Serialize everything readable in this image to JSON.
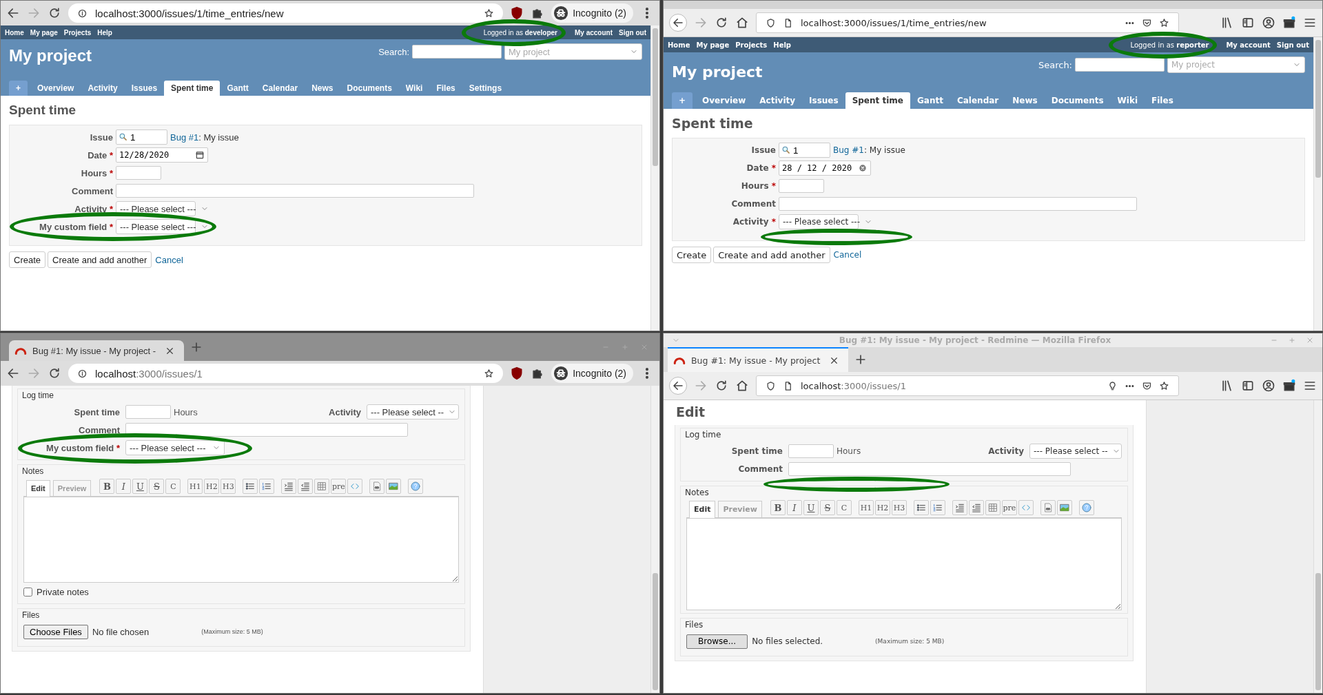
{
  "windows": [
    {
      "kind": "chrome",
      "address": {
        "host": "localhost",
        "path": ":3000/issues/1/time_entries/new",
        "path_dimmed": false
      },
      "profile": "Incognito (2)",
      "page": {
        "kind": "time_entry_form",
        "header": {
          "menu": [
            "Home",
            "My page",
            "Projects",
            "Help"
          ],
          "logged_in_label": "Logged in as",
          "user": "developer",
          "user_circled": true,
          "account_links": [
            "My account",
            "Sign out"
          ],
          "project": "My project",
          "search_label": "Search:",
          "jump": "My project",
          "tabs": [
            {
              "label": "+",
              "kind": "plus",
              "selected": false
            },
            {
              "label": "Overview",
              "kind": "menu",
              "selected": false
            },
            {
              "label": "Activity",
              "kind": "menu",
              "selected": false
            },
            {
              "label": "Issues",
              "kind": "menu",
              "selected": false
            },
            {
              "label": "Spent time",
              "kind": "menu",
              "selected": true
            },
            {
              "label": "Gantt",
              "kind": "menu",
              "selected": false
            },
            {
              "label": "Calendar",
              "kind": "menu",
              "selected": false
            },
            {
              "label": "News",
              "kind": "menu",
              "selected": false
            },
            {
              "label": "Documents",
              "kind": "menu",
              "selected": false
            },
            {
              "label": "Wiki",
              "kind": "menu",
              "selected": false
            },
            {
              "label": "Files",
              "kind": "menu",
              "selected": false
            },
            {
              "label": "Settings",
              "kind": "menu",
              "selected": false
            }
          ]
        },
        "heading": "Spent time",
        "form": {
          "rows": [
            {
              "kind": "issue",
              "label": "Issue",
              "value": "1",
              "link": "Bug #1",
              "text": ": My issue"
            },
            {
              "kind": "date",
              "label": "Date",
              "required_mark": "*",
              "value": "12/28/2020"
            },
            {
              "kind": "short",
              "label": "Hours",
              "required_mark": "*"
            },
            {
              "kind": "long",
              "label": "Comment"
            },
            {
              "kind": "select",
              "label": "Activity",
              "required_mark": "*",
              "value": "--- Please select ---"
            },
            {
              "kind": "select",
              "label": "My custom field",
              "required_mark": "*",
              "value": "--- Please select ---",
              "circled": true
            }
          ],
          "buttons": [
            "Create",
            "Create and add another"
          ],
          "cancel": "Cancel"
        }
      }
    },
    {
      "kind": "firefox",
      "tab_strip": {
        "kind": "partial"
      },
      "address": {
        "host": "localhost",
        "path": ":3000/issues/1/time_entries/new",
        "path_dimmed": false
      },
      "page": {
        "kind": "time_entry_form",
        "header": {
          "menu": [
            "Home",
            "My page",
            "Projects",
            "Help"
          ],
          "logged_in_label": "Logged in as",
          "user": "reporter",
          "user_circled": true,
          "account_links": [
            "My account",
            "Sign out"
          ],
          "project": "My project",
          "search_label": "Search:",
          "jump": "My project",
          "tabs": [
            {
              "label": "+",
              "kind": "plus",
              "selected": false
            },
            {
              "label": "Overview",
              "kind": "menu",
              "selected": false
            },
            {
              "label": "Activity",
              "kind": "menu",
              "selected": false
            },
            {
              "label": "Issues",
              "kind": "menu",
              "selected": false
            },
            {
              "label": "Spent time",
              "kind": "menu",
              "selected": true
            },
            {
              "label": "Gantt",
              "kind": "menu",
              "selected": false
            },
            {
              "label": "Calendar",
              "kind": "menu",
              "selected": false
            },
            {
              "label": "News",
              "kind": "menu",
              "selected": false
            },
            {
              "label": "Documents",
              "kind": "menu",
              "selected": false
            },
            {
              "label": "Wiki",
              "kind": "menu",
              "selected": false
            },
            {
              "label": "Files",
              "kind": "menu",
              "selected": false
            }
          ]
        },
        "heading": "Spent time",
        "form": {
          "rows": [
            {
              "kind": "issue",
              "label": "Issue",
              "value": "1",
              "link": "Bug #1",
              "text": ": My issue"
            },
            {
              "kind": "date",
              "label": "Date",
              "required_mark": "*",
              "value": "28 / 12 / 2020"
            },
            {
              "kind": "short",
              "label": "Hours",
              "required_mark": "*"
            },
            {
              "kind": "long",
              "label": "Comment"
            },
            {
              "kind": "select",
              "label": "Activity",
              "required_mark": "*",
              "value": "--- Please select ---"
            }
          ],
          "circled_gap": true,
          "buttons": [
            "Create",
            "Create and add another"
          ],
          "cancel": "Cancel"
        }
      }
    },
    {
      "kind": "chrome",
      "tab_strip": {
        "kind": "full",
        "title": "Bug #1: My issue - My project -"
      },
      "address": {
        "host": "localhost",
        "path": ":3000/issues/1",
        "path_dimmed": true
      },
      "profile": "Incognito (2)",
      "page": {
        "kind": "issue_edit",
        "log_time": {
          "legend": "Log time",
          "spent_label": "Spent time",
          "unit": "Hours",
          "activity_label": "Activity",
          "activity_value": "--- Please select --",
          "comment_label": "Comment",
          "custom_field": {
            "label": "My custom field",
            "required_mark": "*",
            "value": "--- Please select ---",
            "circled": true
          }
        },
        "notes": {
          "legend": "Notes",
          "tabs": [
            {
              "label": "Edit",
              "selected": true
            },
            {
              "label": "Preview",
              "selected": false
            }
          ],
          "toolbar_groups": [
            [
              {
                "kind": "bold",
                "label": "B"
              },
              {
                "kind": "italic",
                "label": "I"
              },
              {
                "kind": "underline",
                "label": "U"
              },
              {
                "kind": "strike",
                "label": "S"
              },
              {
                "kind": "plain",
                "label": "C"
              }
            ],
            [
              {
                "kind": "plain",
                "label": "H1"
              },
              {
                "kind": "plain",
                "label": "H2"
              },
              {
                "kind": "plain",
                "label": "H3"
              }
            ],
            [
              {
                "kind": "bullet-list"
              },
              {
                "kind": "numbered-list"
              }
            ],
            [
              {
                "kind": "indent"
              },
              {
                "kind": "outdent"
              },
              {
                "kind": "table"
              },
              {
                "kind": "plain",
                "label": "pre"
              },
              {
                "kind": "code"
              }
            ],
            [
              {
                "kind": "link"
              },
              {
                "kind": "image"
              }
            ],
            [
              {
                "kind": "help"
              }
            ]
          ],
          "private_notes": {
            "label": "Private notes",
            "checked": false
          }
        },
        "files": {
          "legend": "Files",
          "button": "Choose Files",
          "status": "No file chosen",
          "max_size": "(Maximum size: 5 MB)"
        }
      }
    },
    {
      "kind": "firefox",
      "title_bar": "Bug #1: My issue - My project - Redmine — Mozilla Firefox",
      "tab_strip": {
        "kind": "full",
        "title": "Bug #1: My issue - My project"
      },
      "address": {
        "host": "localhost",
        "path": ":3000/issues/1",
        "path_dimmed": true
      },
      "page": {
        "kind": "issue_edit",
        "heading": "Edit",
        "log_time": {
          "legend": "Log time",
          "spent_label": "Spent time",
          "unit": "Hours",
          "activity_label": "Activity",
          "activity_value": "--- Please select --",
          "comment_label": "Comment",
          "circled_gap": true
        },
        "notes": {
          "legend": "Notes",
          "tabs": [
            {
              "label": "Edit",
              "selected": true
            },
            {
              "label": "Preview",
              "selected": false
            }
          ],
          "toolbar_groups": [
            [
              {
                "kind": "bold",
                "label": "B"
              },
              {
                "kind": "italic",
                "label": "I"
              },
              {
                "kind": "underline",
                "label": "U"
              },
              {
                "kind": "strike",
                "label": "S"
              },
              {
                "kind": "plain",
                "label": "C"
              }
            ],
            [
              {
                "kind": "plain",
                "label": "H1"
              },
              {
                "kind": "plain",
                "label": "H2"
              },
              {
                "kind": "plain",
                "label": "H3"
              }
            ],
            [
              {
                "kind": "bullet-list"
              },
              {
                "kind": "numbered-list"
              }
            ],
            [
              {
                "kind": "indent"
              },
              {
                "kind": "outdent"
              },
              {
                "kind": "table"
              },
              {
                "kind": "plain",
                "label": "pre"
              },
              {
                "kind": "code"
              }
            ],
            [
              {
                "kind": "link"
              },
              {
                "kind": "image"
              }
            ],
            [
              {
                "kind": "help"
              }
            ]
          ]
        },
        "files": {
          "legend": "Files",
          "button": "Browse...",
          "status": "No files selected.",
          "max_size": "(Maximum size: 5 MB)"
        }
      }
    }
  ]
}
